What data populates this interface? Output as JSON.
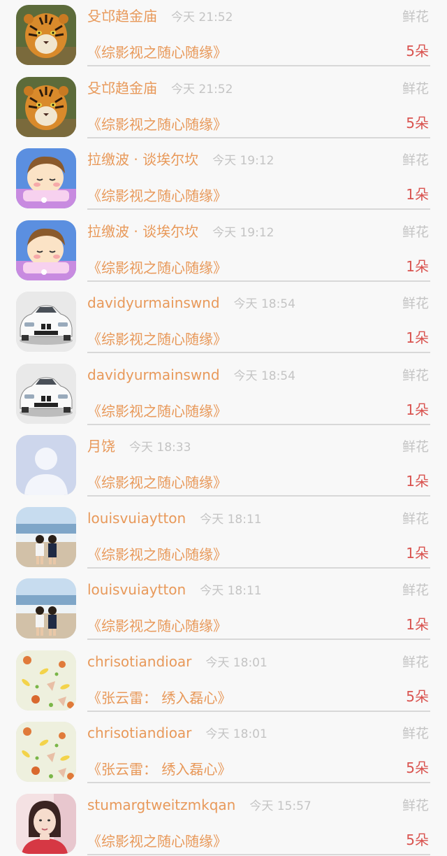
{
  "gifts": [
    {
      "avatar": "tiger-avatar",
      "username": "殳邙趋金庙",
      "time": "今天 21:52",
      "gift_type": "鲜花",
      "book": "《综影视之随心随缘》",
      "count": "5朵"
    },
    {
      "avatar": "tiger-avatar",
      "username": "殳邙趋金庙",
      "time": "今天 21:52",
      "gift_type": "鲜花",
      "book": "《综影视之随心随缘》",
      "count": "5朵"
    },
    {
      "avatar": "cartoon-girl-avatar",
      "username": "拉缴波 · 谈埃尔坎",
      "time": "今天 19:12",
      "gift_type": "鲜花",
      "book": "《综影视之随心随缘》",
      "count": "1朵"
    },
    {
      "avatar": "cartoon-girl-avatar",
      "username": "拉缴波 · 谈埃尔坎",
      "time": "今天 19:12",
      "gift_type": "鲜花",
      "book": "《综影视之随心随缘》",
      "count": "1朵"
    },
    {
      "avatar": "white-car-avatar",
      "username": "davidyurmainswnd",
      "time": "今天 18:54",
      "gift_type": "鲜花",
      "book": "《综影视之随心随缘》",
      "count": "1朵"
    },
    {
      "avatar": "white-car-avatar",
      "username": "davidyurmainswnd",
      "time": "今天 18:54",
      "gift_type": "鲜花",
      "book": "《综影视之随心随缘》",
      "count": "1朵"
    },
    {
      "avatar": "default-user-avatar",
      "username": "月饶",
      "time": "今天 18:33",
      "gift_type": "鲜花",
      "book": "《综影视之随心随缘》",
      "count": "1朵"
    },
    {
      "avatar": "beach-couple-avatar",
      "username": "louisvuiaytton",
      "time": "今天 18:11",
      "gift_type": "鲜花",
      "book": "《综影视之随心随缘》",
      "count": "1朵"
    },
    {
      "avatar": "beach-couple-avatar",
      "username": "louisvuiaytton",
      "time": "今天 18:11",
      "gift_type": "鲜花",
      "book": "《综影视之随心随缘》",
      "count": "1朵"
    },
    {
      "avatar": "fruit-pattern-avatar",
      "username": "chrisotiandioar",
      "time": "今天 18:01",
      "gift_type": "鲜花",
      "book": "《张云雷： 绣入磊心》",
      "count": "5朵"
    },
    {
      "avatar": "fruit-pattern-avatar",
      "username": "chrisotiandioar",
      "time": "今天 18:01",
      "gift_type": "鲜花",
      "book": "《张云雷： 绣入磊心》",
      "count": "5朵"
    },
    {
      "avatar": "girl-photo-avatar",
      "username": "stumargtweitzmkqan",
      "time": "今天 15:57",
      "gift_type": "鲜花",
      "book": "《综影视之随心随缘》",
      "count": "5朵"
    }
  ]
}
